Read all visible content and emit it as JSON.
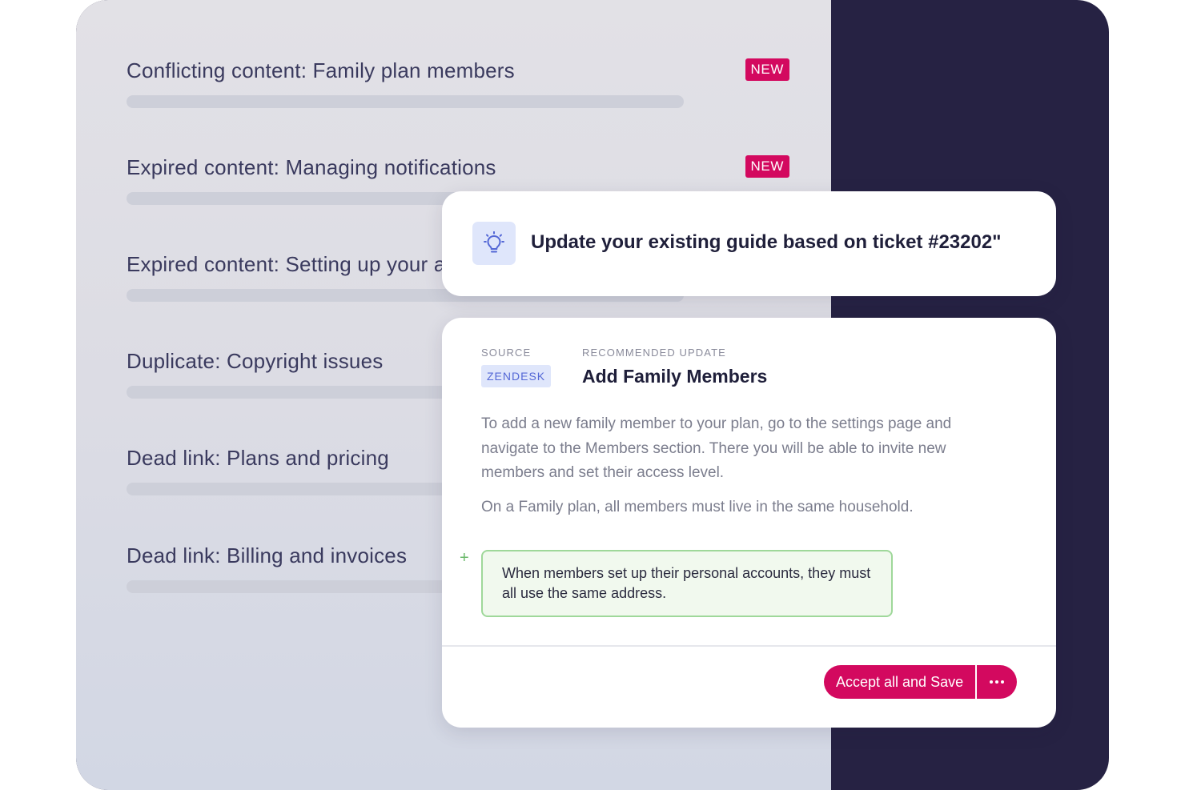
{
  "issues": [
    {
      "title": "Conflicting content: Family plan members",
      "badge": "NEW"
    },
    {
      "title": "Expired content: Managing notifications",
      "badge": "NEW"
    },
    {
      "title": "Expired content: Setting up your account"
    },
    {
      "title": "Duplicate: Copyright issues"
    },
    {
      "title": "Dead link: Plans and pricing"
    },
    {
      "title": "Dead link: Billing and invoices"
    }
  ],
  "suggestion": {
    "icon": "lightbulb-icon",
    "text": "Update your existing guide based on ticket #23202\""
  },
  "recommendation": {
    "source_label": "SOURCE",
    "source_value": "ZENDESK",
    "update_label": "RECOMMENDED UPDATE",
    "title": "Add Family Members",
    "paragraph1": "To add a new family member to your plan, go to the settings page and navigate to the Members section. There you will be able to invite new members and set their access level.",
    "paragraph2": "On a Family plan, all members must live in the same household.",
    "added_marker": "+",
    "added_text": "When members set up their personal accounts, they must all use the same address.",
    "accept_button": "Accept all and Save",
    "more_icon": "more-dots-icon"
  },
  "colors": {
    "accent": "#d3095f",
    "dark_panel": "#262243",
    "added_border": "#9fd89a",
    "chip_text": "#5468d6"
  }
}
